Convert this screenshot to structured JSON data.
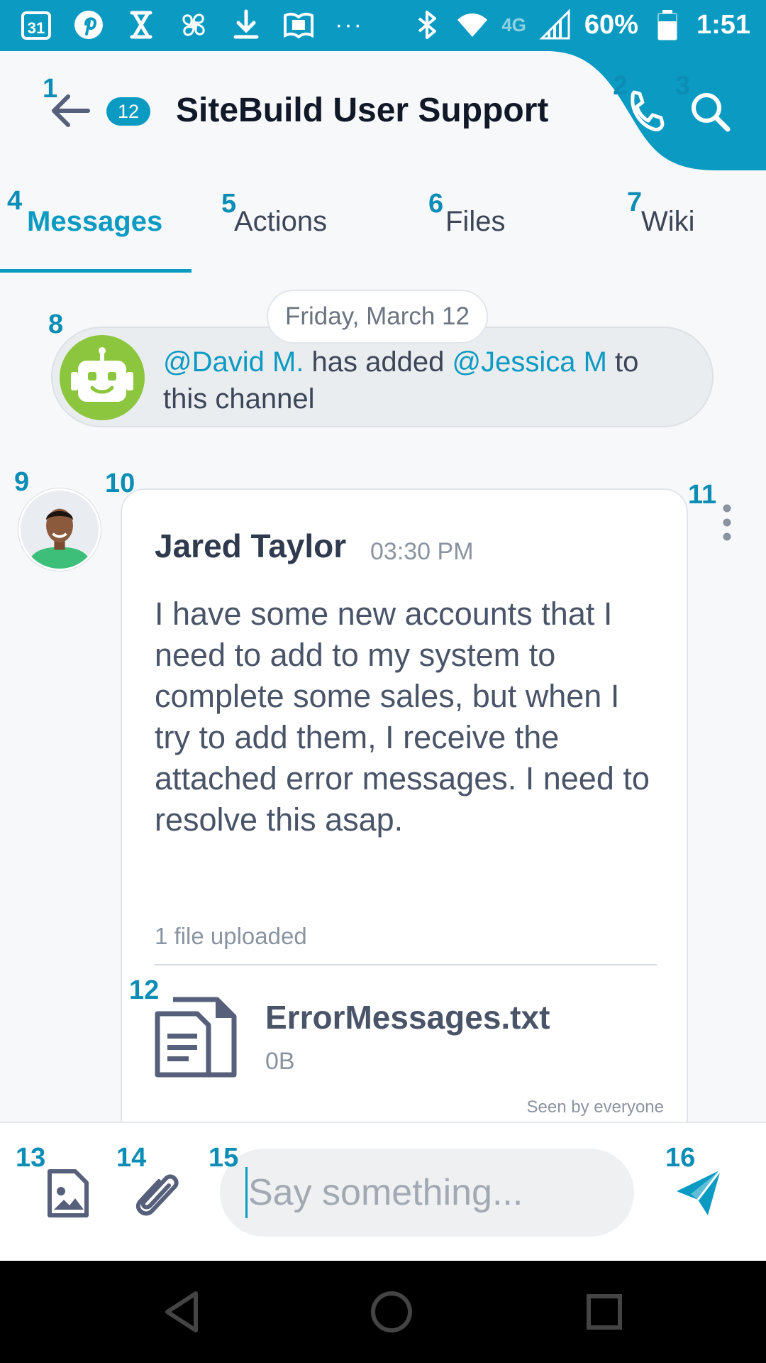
{
  "status_bar": {
    "left_icons": [
      "calendar-icon",
      "pinterest-icon",
      "hourglass-icon",
      "pinwheel-icon",
      "download-icon",
      "amazon-kindle-icon",
      "more-notifications-icon"
    ],
    "calendar_day": "31",
    "overflow_dots": "···",
    "network": "4G",
    "battery": "60%",
    "time": "1:51"
  },
  "header": {
    "unread_count": "12",
    "title": "SiteBuild User Support",
    "back_icon": "arrow-left-icon",
    "call_icon": "phone-icon",
    "search_icon": "search-icon"
  },
  "tabs": [
    {
      "label": "Messages",
      "active": true
    },
    {
      "label": "Actions",
      "active": false
    },
    {
      "label": "Files",
      "active": false
    },
    {
      "label": "Wiki",
      "active": false
    }
  ],
  "annotations": [
    "1",
    "2",
    "3",
    "4",
    "5",
    "6",
    "7",
    "8",
    "9",
    "10",
    "11",
    "12",
    "13",
    "14",
    "15",
    "16"
  ],
  "date_divider": "Friday, March 12",
  "system_message": {
    "actor": "@David M.",
    "verb": " has added ",
    "target": "@Jessica M",
    "suffix": " to this channel"
  },
  "message": {
    "sender": "Jared Taylor",
    "time": "03:30 PM",
    "body": "I have some new accounts that I need to add to my system to complete some sales, but when I try to add them, I receive the attached error messages. I need to resolve this asap.",
    "uploads_label": "1 file uploaded",
    "file": {
      "name": "ErrorMessages.txt",
      "size": "0B"
    },
    "read_receipt": "Seen by everyone"
  },
  "composer": {
    "placeholder": "Say something...",
    "value": ""
  },
  "colors": {
    "brand": "#0b9ac2",
    "bot": "#8cc63f",
    "text": "#2f3a4f"
  }
}
